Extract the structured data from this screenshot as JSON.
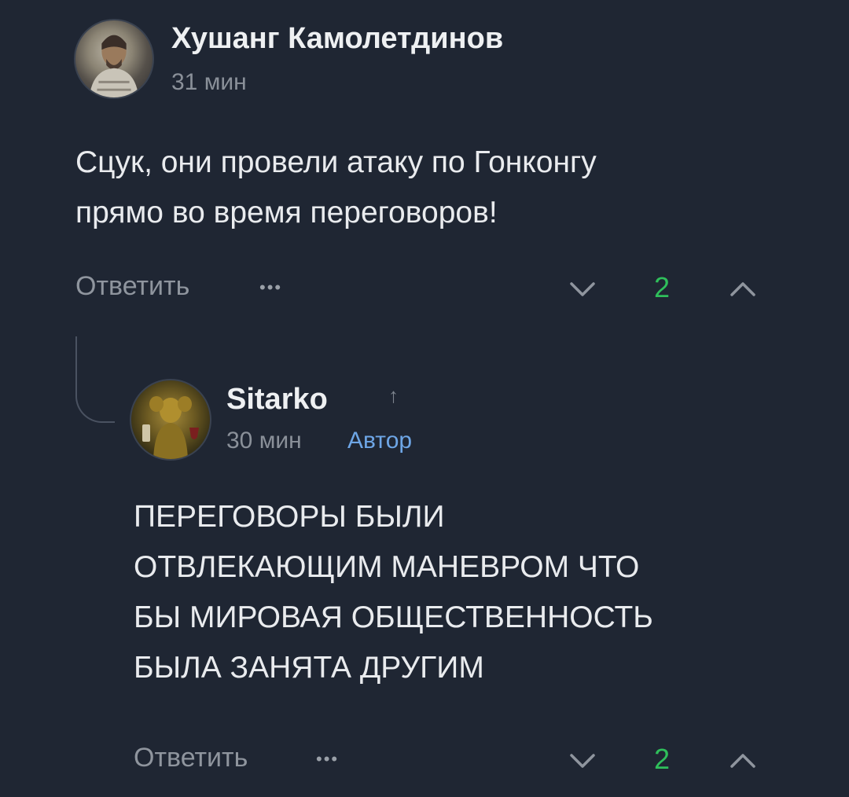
{
  "comments": [
    {
      "author": "Хушанг Камолетдинов",
      "time": "31 мин",
      "text_lines": [
        "Сцук, они провели атаку по Гонконгу",
        "прямо во время переговоров!"
      ],
      "reply_label": "Ответить",
      "more_label": "•••",
      "score": "2",
      "avatar_icon": "avatar-knight",
      "score_color": "#2fbf5b"
    },
    {
      "author": "Sitarko",
      "author_arrow": "↑",
      "time": "30 мин",
      "badge": "Автор",
      "text_lines": [
        "ПЕРЕГОВОРЫ БЫЛИ",
        "ОТВЛЕКАЮЩИМ МАНЕВРОМ ЧТО",
        "БЫ МИРОВАЯ ОБЩЕСТВЕННОСТЬ",
        "БЫЛА ЗАНЯТА ДРУГИМ"
      ],
      "reply_label": "Ответить",
      "more_label": "•••",
      "score": "2",
      "avatar_icon": "avatar-lizard",
      "badge_color": "#6ea6e6",
      "score_color": "#2fbf5b"
    }
  ],
  "theme": {
    "background": "#1f2633",
    "text": "#e9ebee",
    "muted": "#8f959e"
  }
}
